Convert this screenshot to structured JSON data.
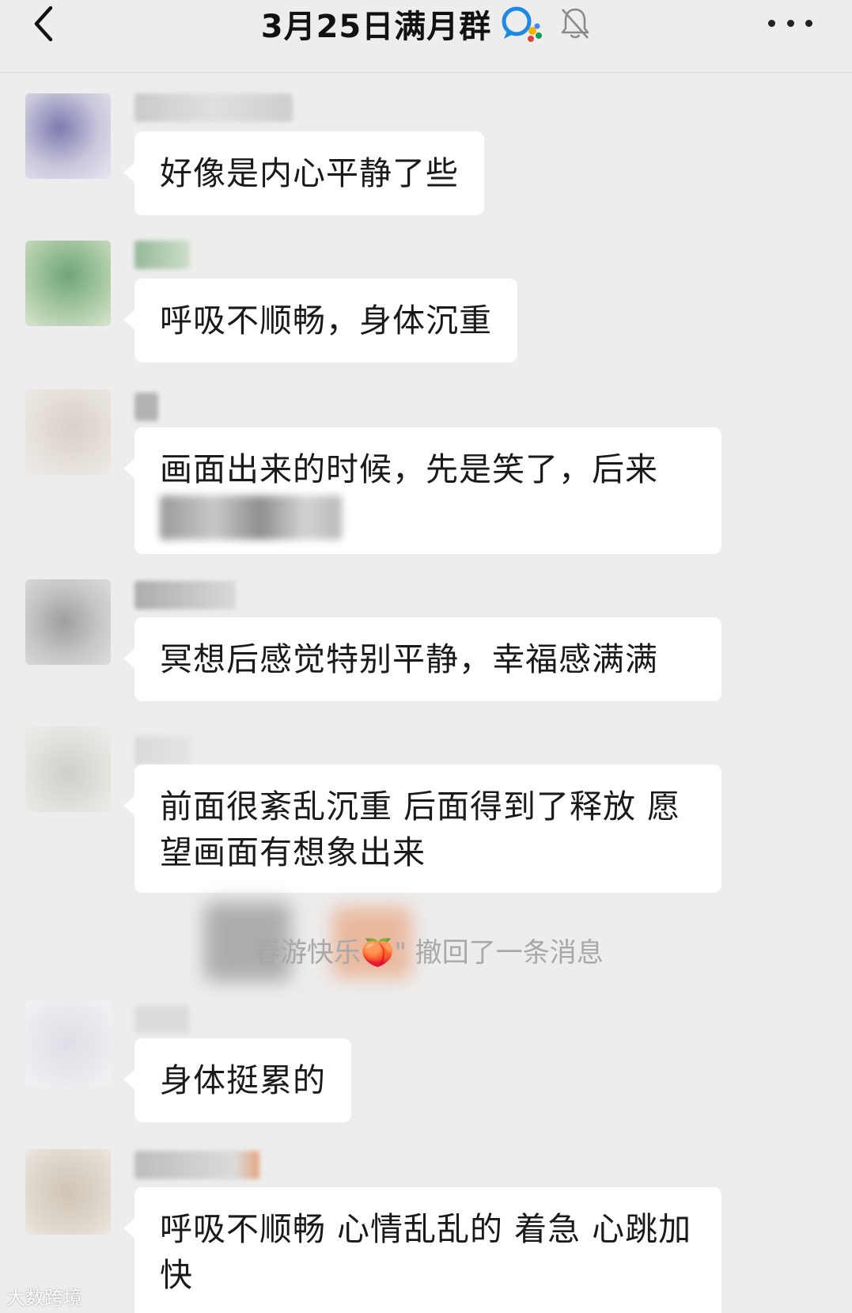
{
  "header": {
    "title": "3月25日满月群",
    "back_icon": "chevron-left-icon",
    "group_icon": "group-chat-icon",
    "mute_icon": "bell-muted-icon",
    "more_icon": "more-dots-icon"
  },
  "messages": [
    {
      "text_lines": [
        "好像是内心平静了些"
      ]
    },
    {
      "text_lines": [
        "呼吸不顺畅，身体沉重"
      ]
    },
    {
      "text_lines": [
        "画面出来的时候，先是笑了，后来"
      ]
    },
    {
      "text_lines": [
        "冥想后感觉特别平静，幸福感满满"
      ]
    },
    {
      "text_lines": [
        "前面很紊乱沉重 后面得到了释放 愿",
        "望画面有想象出来"
      ]
    },
    {
      "text_lines": [
        "身体挺累的"
      ]
    },
    {
      "text_lines": [
        "呼吸不顺畅 心情乱乱的 着急 心跳加",
        "快"
      ]
    }
  ],
  "system_notice": {
    "prefix": "春游快乐",
    "emoji": "🍑",
    "suffix": "\" 撤回了一条消息"
  },
  "watermark": "大数跨境"
}
